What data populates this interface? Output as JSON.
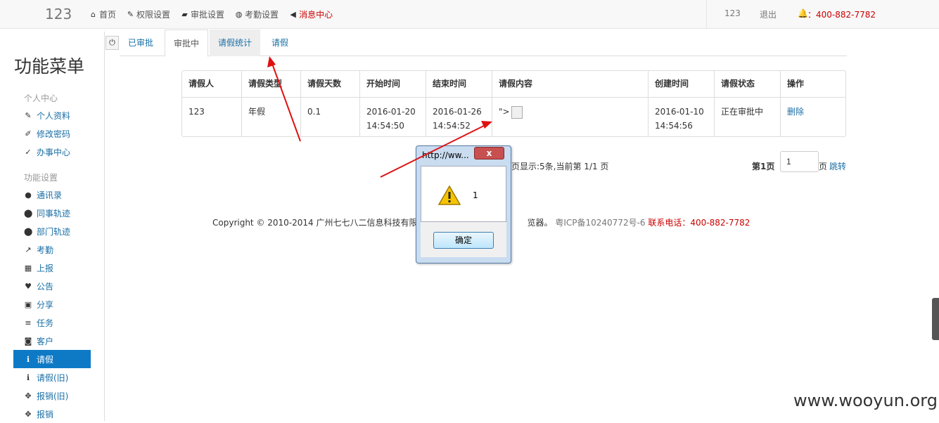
{
  "topbar": {
    "brand": "123",
    "nav": [
      {
        "icon": "home-icon",
        "glyph": "⌂",
        "label": "首页"
      },
      {
        "icon": "wrench-icon",
        "glyph": "✎",
        "label": "权限设置"
      },
      {
        "icon": "folder-open-icon",
        "glyph": "▰",
        "label": "审批设置"
      },
      {
        "icon": "globe-icon",
        "glyph": "◍",
        "label": "考勤设置"
      },
      {
        "icon": "bullhorn-icon",
        "glyph": "◀",
        "label": "消息中心"
      }
    ],
    "user": "123",
    "logout": "退出",
    "phone": "400-882-7782"
  },
  "sidebar": {
    "title": "功能菜单",
    "groups": [
      {
        "label": "个人中心"
      },
      {
        "label": "功能设置"
      }
    ],
    "items": [
      {
        "icon": "edit-icon",
        "glyph": "✎",
        "label": "个人资料"
      },
      {
        "icon": "pencil-icon",
        "glyph": "✐",
        "label": "修改密码"
      },
      {
        "icon": "check-circle-icon",
        "glyph": "✓",
        "label": "办事中心"
      },
      {
        "icon": "user-icon",
        "glyph": "●",
        "label": "通讯录"
      },
      {
        "icon": "map-marker-icon",
        "glyph": "⬤",
        "label": "同事轨迹"
      },
      {
        "icon": "map-marker-icon",
        "glyph": "⬤",
        "label": "部门轨迹"
      },
      {
        "icon": "signal-icon",
        "glyph": "↗",
        "label": "考勤"
      },
      {
        "icon": "calendar-icon",
        "glyph": "▦",
        "label": "上报"
      },
      {
        "icon": "heart-icon",
        "glyph": "♥",
        "label": "公告"
      },
      {
        "icon": "gift-icon",
        "glyph": "▣",
        "label": "分享"
      },
      {
        "icon": "list-icon",
        "glyph": "≡",
        "label": "任务"
      },
      {
        "icon": "camera-icon",
        "glyph": "◙",
        "label": "客户"
      },
      {
        "icon": "info-icon",
        "glyph": "ℹ",
        "label": "请假"
      },
      {
        "icon": "info-icon",
        "glyph": "ℹ",
        "label": "请假(旧)"
      },
      {
        "icon": "move-icon",
        "glyph": "✥",
        "label": "报销(旧)"
      },
      {
        "icon": "move-icon",
        "glyph": "✥",
        "label": "报销"
      }
    ]
  },
  "tabs": [
    "已审批",
    "审批中",
    "请假统计",
    "请假"
  ],
  "table": {
    "headers": [
      "请假人",
      "请假类型",
      "请假天数",
      "开始时间",
      "结束时间",
      "请假内容",
      "创建时间",
      "请假状态",
      "操作"
    ],
    "row": {
      "person": "123",
      "type": "年假",
      "days": "0.1",
      "start_date": "2016-01-20",
      "start_time": "14:54:50",
      "end_date": "2016-01-26",
      "end_time": "14:54:52",
      "content": "\">",
      "created_date": "2016-01-10",
      "created_time": "14:54:56",
      "status": "正在审批中",
      "action": "删除"
    }
  },
  "pager": {
    "info": "页显示:5条,当前第 1/1 页",
    "page_label": "第1页",
    "page_value": "1",
    "ye": "页",
    "jump": "跳转"
  },
  "footer": {
    "copyright": "Copyright © 2010-2014 广州七七八二信息科技有限公司",
    "browser": "览器。",
    "icp": "粤ICP备10240772号-6",
    "tel": "联系电话：400-882-7782"
  },
  "dialog": {
    "title": "http://ww...",
    "close": "x",
    "message": "1",
    "ok": "确定"
  },
  "watermark": "www.wooyun.org",
  "colors": {
    "accent": "#0e7ac6",
    "link": "#1a6fa6",
    "alert": "#cc0000",
    "arrow": "#e01010"
  }
}
